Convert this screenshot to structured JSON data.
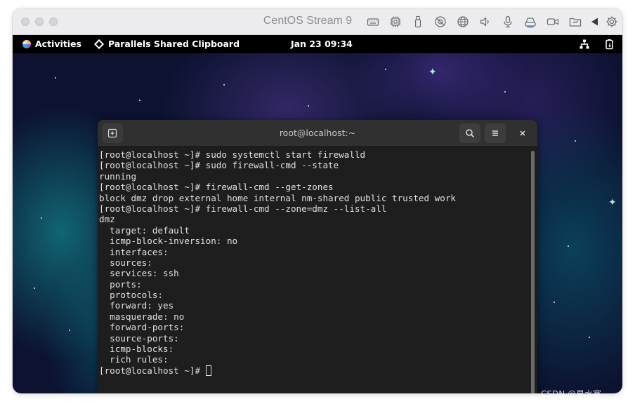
{
  "vm_window": {
    "title": "CentOS Stream 9",
    "toolbar_icons": [
      "keyboard-icon",
      "cpu-icon",
      "usb-icon",
      "no-camera-icon",
      "network-icon",
      "speaker-icon",
      "microphone-icon",
      "printer-icon",
      "camera-icon",
      "shared-folder-icon",
      "back-arrow-icon",
      "gear-icon"
    ]
  },
  "gnome_bar": {
    "activities_label": "Activities",
    "app_label": "Parallels Shared Clipboard",
    "clock": "Jan 23  09:34",
    "tray_icons": [
      "network-icon",
      "power-icon"
    ]
  },
  "terminal": {
    "title": "root@localhost:~",
    "prompt": "[root@localhost ~]# ",
    "lines": [
      "[root@localhost ~]# sudo systemctl start firewalld",
      "[root@localhost ~]# sudo firewall-cmd --state",
      "running",
      "[root@localhost ~]# firewall-cmd --get-zones",
      "block dmz drop external home internal nm-shared public trusted work",
      "[root@localhost ~]# firewall-cmd --zone=dmz --list-all",
      "dmz",
      "  target: default",
      "  icmp-block-inversion: no",
      "  interfaces: ",
      "  sources: ",
      "  services: ssh",
      "  ports: ",
      "  protocols: ",
      "  forward: yes",
      "  masquerade: no",
      "  forward-ports: ",
      "  source-ports: ",
      "  icmp-blocks: ",
      "  rich rules: "
    ]
  },
  "watermark": "CSDN @易水寒"
}
